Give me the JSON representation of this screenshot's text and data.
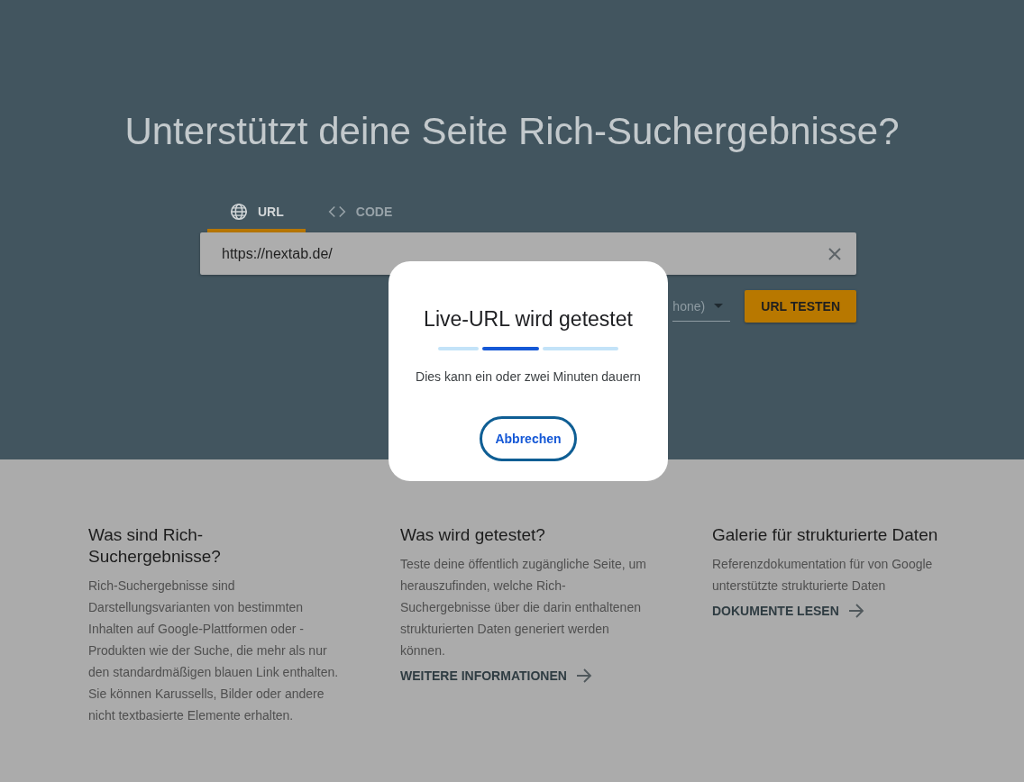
{
  "heading": "Unterstützt deine Seite Rich-Suchergebnisse?",
  "tabs": [
    {
      "label": "URL",
      "selected": true
    },
    {
      "label": "CODE",
      "selected": false
    }
  ],
  "url_field": {
    "value": "https://nextab.de/"
  },
  "device_select": {
    "value": "hone)"
  },
  "test_button": "URL TESTEN",
  "dialog": {
    "title": "Live-URL wird getestet",
    "message": "Dies kann ein oder zwei Minuten dauern",
    "cancel": "Abbrechen"
  },
  "info_columns": [
    {
      "title": "Was sind Rich-Suchergebnisse?",
      "text": "Rich-Suchergebnisse sind Darstellungsvarianten von bestimmten Inhalten auf Google-Plattformen oder -Produkten wie der Suche, die mehr als nur den standardmäßigen blauen Link enthalten. Sie können Karussells, Bilder oder andere nicht textbasierte Elemente erhalten."
    },
    {
      "title": "Was wird getestet?",
      "text": "Teste deine öffentlich zugängliche Seite, um herauszufinden, welche Rich-Suchergebnisse über die darin enthaltenen strukturierten Daten generiert werden können.",
      "link": "WEITERE INFORMATIONEN"
    },
    {
      "title": "Galerie für strukturierte Daten",
      "text": "Referenzdokumentation für von Google unterstützte strukturierte Daten",
      "link": "DOKUMENTE LESEN"
    }
  ]
}
